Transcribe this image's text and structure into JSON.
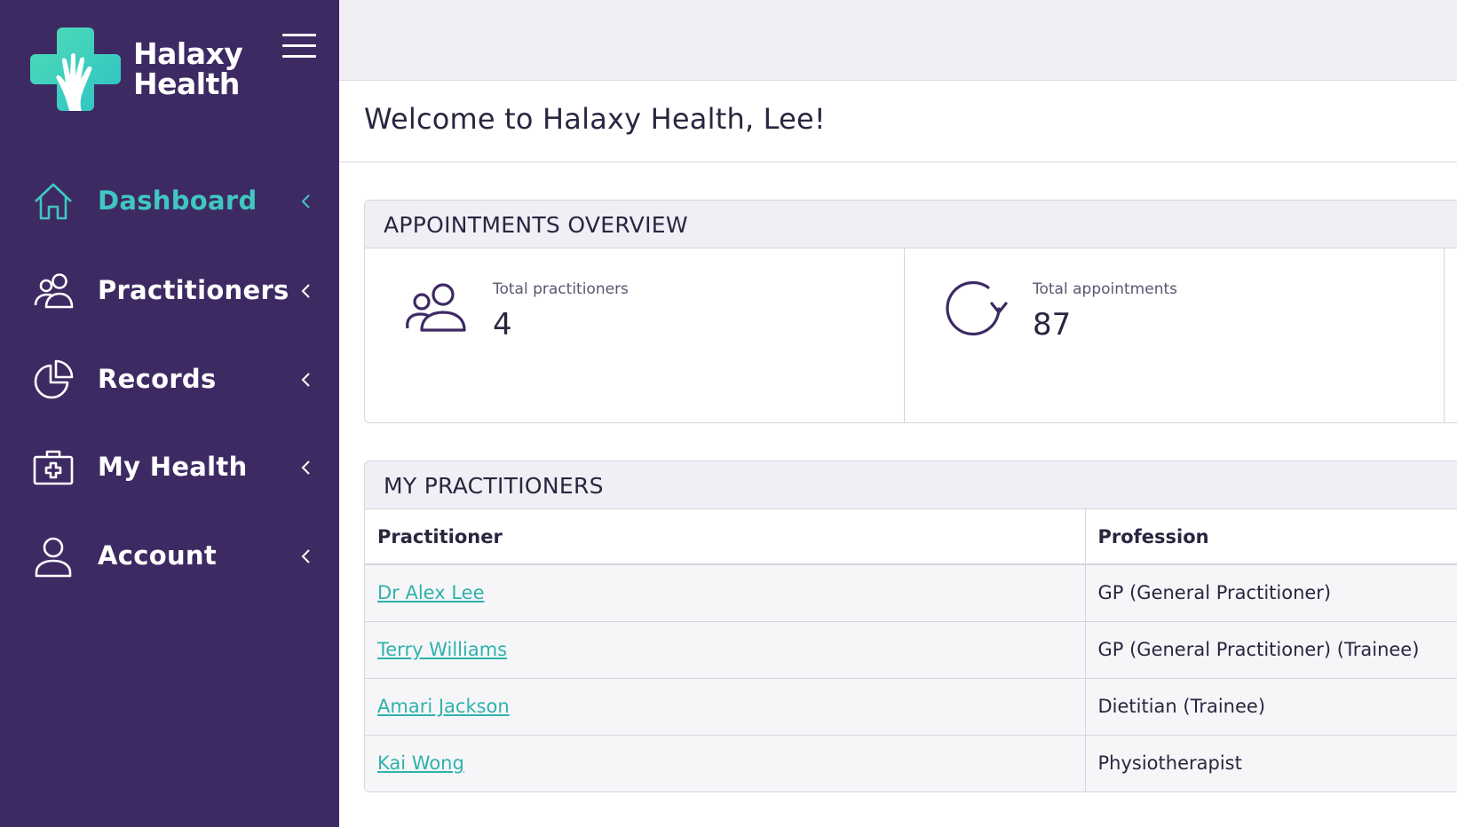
{
  "brand": {
    "line1": "Halaxy",
    "line2": "Health"
  },
  "sidebar": {
    "items": [
      {
        "label": "Dashboard",
        "icon": "home-icon",
        "active": true
      },
      {
        "label": "Practitioners",
        "icon": "users-icon",
        "active": false
      },
      {
        "label": "Records",
        "icon": "pie-chart-icon",
        "active": false
      },
      {
        "label": "My Health",
        "icon": "medical-kit-icon",
        "active": false
      },
      {
        "label": "Account",
        "icon": "user-icon",
        "active": false
      }
    ]
  },
  "header": {
    "title": "Welcome to Halaxy Health, Lee!"
  },
  "overview": {
    "title": "APPOINTMENTS OVERVIEW",
    "stats": [
      {
        "label": "Total practitioners",
        "value": "4",
        "icon": "users-icon"
      },
      {
        "label": "Total appointments",
        "value": "87",
        "icon": "refresh-icon"
      }
    ]
  },
  "practitioners": {
    "title": "MY PRACTITIONERS",
    "columns": [
      "Practitioner",
      "Profession"
    ],
    "rows": [
      {
        "name": "Dr Alex Lee",
        "profession": "GP (General Practitioner)"
      },
      {
        "name": "Terry Williams",
        "profession": "GP (General Practitioner) (Trainee)"
      },
      {
        "name": "Amari Jackson",
        "profession": "Dietitian (Trainee)"
      },
      {
        "name": "Kai Wong",
        "profession": "Physiotherapist"
      }
    ]
  },
  "colors": {
    "sidebar": "#3e2a63",
    "accent": "#3fc7c0",
    "link": "#2fb2ab",
    "panel_head": "#f0eff5"
  }
}
